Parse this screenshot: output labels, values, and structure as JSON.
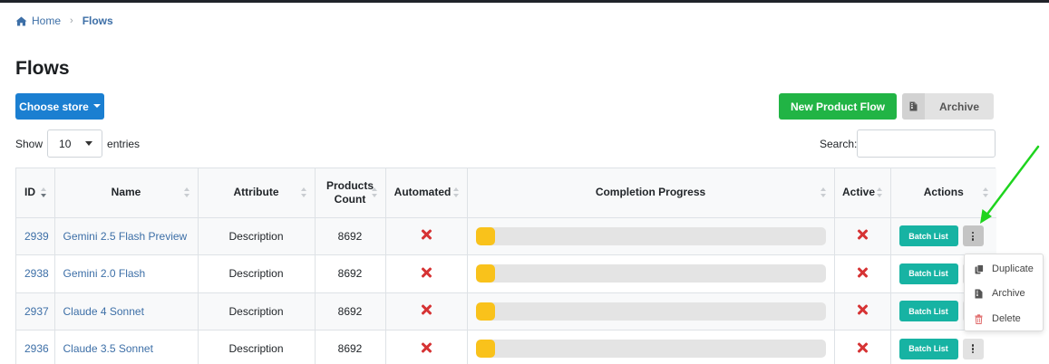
{
  "breadcrumb": {
    "home": "Home",
    "separator": "›",
    "current": "Flows"
  },
  "page_title": "Flows",
  "toolbar": {
    "store_button": "Choose store",
    "new_flow_button": "New Product Flow",
    "archive_button": "Archive"
  },
  "entries": {
    "show_label": "Show",
    "value": "10",
    "suffix": "entries"
  },
  "search": {
    "label": "Search:",
    "value": ""
  },
  "table": {
    "columns": [
      "ID",
      "Name",
      "Attribute",
      "Products Count",
      "Automated",
      "Completion Progress",
      "Active",
      "Actions"
    ],
    "rows": [
      {
        "id": "2939",
        "name": "Gemini 2.5 Flash Preview",
        "attribute": "Description",
        "count": "8692",
        "automated": false,
        "progress": 0.055,
        "active": false,
        "batch": "Batch List"
      },
      {
        "id": "2938",
        "name": "Gemini 2.0 Flash",
        "attribute": "Description",
        "count": "8692",
        "automated": false,
        "progress": 0.055,
        "active": false,
        "batch": "Batch List"
      },
      {
        "id": "2937",
        "name": "Claude 4 Sonnet",
        "attribute": "Description",
        "count": "8692",
        "automated": false,
        "progress": 0.055,
        "active": false,
        "batch": "Batch List"
      },
      {
        "id": "2936",
        "name": "Claude 3.5 Sonnet",
        "attribute": "Description",
        "count": "8692",
        "automated": false,
        "progress": 0.055,
        "active": false,
        "batch": "Batch List"
      }
    ]
  },
  "dropdown_menu": {
    "items": [
      {
        "label": "Duplicate",
        "icon": "copy-icon"
      },
      {
        "label": "Archive",
        "icon": "archive-file-icon"
      },
      {
        "label": "Delete",
        "icon": "trash-icon"
      }
    ]
  },
  "colors": {
    "primary": "#1b7fd1",
    "success": "#21b445",
    "teal": "#17b3a3",
    "danger": "#d63334",
    "progress_fill": "#f9c21b",
    "annotation_arrow": "#1ed41e"
  }
}
